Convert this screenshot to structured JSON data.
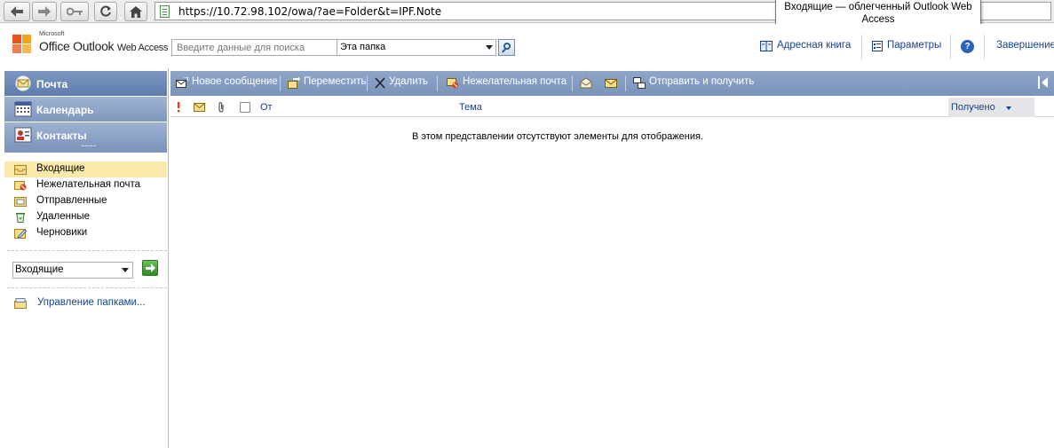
{
  "browser": {
    "url": "https://10.72.98.102/owa/?ae=Folder&t=IPF.Note",
    "tooltip": "Входящие — облегченный Outlook Web Access"
  },
  "header": {
    "logo_brand": "Microsoft",
    "logo_product": "Office Outlook",
    "logo_suffix": "Web Access",
    "search_placeholder": "Введите данные для поиска",
    "search_scope": "Эта папка",
    "links": {
      "address_book": "Адресная книга",
      "options": "Параметры",
      "help": "?",
      "logoff": "Завершение"
    }
  },
  "nav": {
    "modules": [
      {
        "label": "Почта",
        "icon": "mail-icon",
        "active": true
      },
      {
        "label": "Календарь",
        "icon": "calendar-icon",
        "active": false
      },
      {
        "label": "Контакты",
        "icon": "contacts-icon",
        "active": false
      }
    ],
    "folders": [
      {
        "label": "Входящие",
        "icon": "inbox-icon",
        "selected": true
      },
      {
        "label": "Нежелательная почта",
        "icon": "junk-folder-icon",
        "selected": false
      },
      {
        "label": "Отправленные",
        "icon": "sent-folder-icon",
        "selected": false
      },
      {
        "label": "Удаленные",
        "icon": "deleted-folder-icon",
        "selected": false
      },
      {
        "label": "Черновики",
        "icon": "drafts-folder-icon",
        "selected": false
      }
    ],
    "folder_select_value": "Входящие",
    "manage_folders": "Управление папками..."
  },
  "toolbar": {
    "new_message": "Новое сообщение",
    "move": "Переместить",
    "delete": "Удалить",
    "junk": "Нежелательная почта",
    "send_receive": "Отправить и получить"
  },
  "columns": {
    "from": "От",
    "subject": "Тема",
    "received": "Получено"
  },
  "empty_message": "В этом представлении отсутствуют элементы для отображения.",
  "colors": {
    "accent_blue": "#15428b",
    "toolbar_blue": "#7f97bd",
    "selected_folder": "#fbe9a9"
  }
}
